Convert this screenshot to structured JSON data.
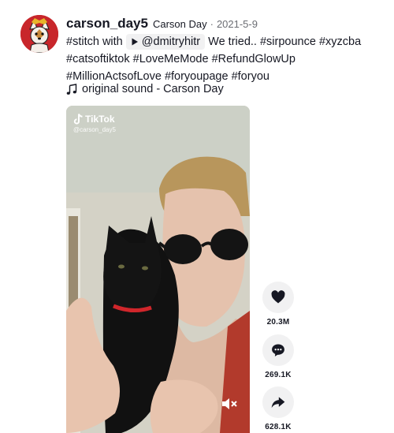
{
  "post": {
    "author": {
      "unique_id": "carson_day5",
      "nickname": "Carson Day",
      "separator": "·",
      "date": "2021-5-9"
    },
    "caption": {
      "stitch_tag": "#stitch",
      "with_text": "with",
      "mention": "@dmitryhitr",
      "text": "We tried..",
      "hashtags": [
        "#sirpounce",
        "#xyzcba",
        "#catsoftiktok",
        "#LoveMeMode",
        "#RefundGlowUp",
        "#MillionActsofLove",
        "#foryoupage",
        "#foryou"
      ]
    },
    "music": {
      "icon": "music-note-icon",
      "title": "original sound - Carson Day"
    },
    "video": {
      "watermark_brand": "TikTok",
      "watermark_handle": "@carson_day5",
      "mute_icon": "volume-muted-icon"
    },
    "actions": {
      "likes": "20.3M",
      "comments": "269.1K",
      "shares": "628.1K"
    }
  },
  "colors": {
    "text": "#161823",
    "secondary_text": "#6b6d73",
    "action_bg": "#f1f1f2",
    "avatar_bg": "#c8262b"
  }
}
